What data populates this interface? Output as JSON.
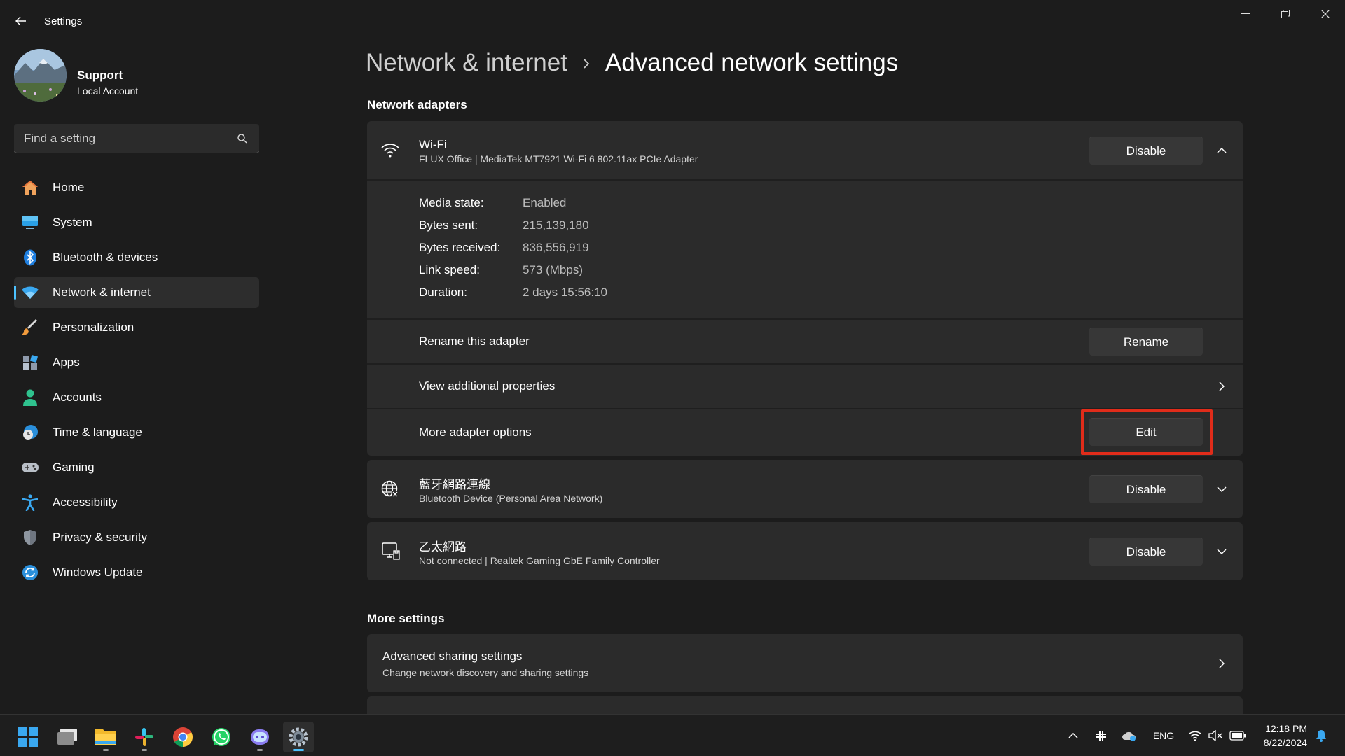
{
  "window": {
    "title": "Settings",
    "back_icon": "back-arrow-icon"
  },
  "profile": {
    "name": "Support",
    "account_type": "Local Account"
  },
  "search": {
    "placeholder": "Find a setting"
  },
  "sidebar": {
    "items": [
      {
        "label": "Home",
        "icon": "home-icon"
      },
      {
        "label": "System",
        "icon": "system-icon"
      },
      {
        "label": "Bluetooth & devices",
        "icon": "bluetooth-icon"
      },
      {
        "label": "Network & internet",
        "icon": "wifi-icon",
        "active": true
      },
      {
        "label": "Personalization",
        "icon": "brush-icon"
      },
      {
        "label": "Apps",
        "icon": "apps-icon"
      },
      {
        "label": "Accounts",
        "icon": "person-icon"
      },
      {
        "label": "Time & language",
        "icon": "clock-globe-icon"
      },
      {
        "label": "Gaming",
        "icon": "gamepad-icon"
      },
      {
        "label": "Accessibility",
        "icon": "accessibility-icon"
      },
      {
        "label": "Privacy & security",
        "icon": "shield-icon"
      },
      {
        "label": "Windows Update",
        "icon": "update-icon"
      }
    ]
  },
  "breadcrumb": {
    "parent": "Network & internet",
    "separator": ">",
    "current": "Advanced network settings"
  },
  "sections": {
    "adapters_title": "Network adapters",
    "more_title": "More settings"
  },
  "wifi_adapter": {
    "name": "Wi-Fi",
    "description": "FLUX Office | MediaTek MT7921 Wi-Fi 6 802.11ax PCIe Adapter",
    "disable_label": "Disable",
    "details": [
      {
        "label": "Media state:",
        "value": "Enabled"
      },
      {
        "label": "Bytes sent:",
        "value": "215,139,180"
      },
      {
        "label": "Bytes received:",
        "value": "836,556,919"
      },
      {
        "label": "Link speed:",
        "value": "573 (Mbps)"
      },
      {
        "label": "Duration:",
        "value": "2 days 15:56:10"
      }
    ],
    "rename_row": {
      "label": "Rename this adapter",
      "button": "Rename"
    },
    "properties_row": {
      "label": "View additional properties"
    },
    "options_row": {
      "label": "More adapter options",
      "button": "Edit"
    }
  },
  "bluetooth_adapter": {
    "name": "藍牙網路連線",
    "description": "Bluetooth Device (Personal Area Network)",
    "disable_label": "Disable"
  },
  "ethernet_adapter": {
    "name": "乙太網路",
    "description": "Not connected | Realtek Gaming GbE Family Controller",
    "disable_label": "Disable"
  },
  "more_settings": [
    {
      "title": "Advanced sharing settings",
      "subtitle": "Change network discovery and sharing settings"
    }
  ],
  "taskbar": {
    "apps": [
      "start-icon",
      "task-view-icon",
      "file-explorer-icon",
      "slack-icon",
      "chrome-icon",
      "whatsapp-icon",
      "copilot-icon",
      "settings-icon"
    ],
    "language": "ENG",
    "time": "12:18 PM",
    "date": "8/22/2024"
  },
  "colors": {
    "accent": "#4cc2ff",
    "highlight": "#e02c1a",
    "background": "#1c1c1c",
    "card": "#2b2b2b"
  }
}
